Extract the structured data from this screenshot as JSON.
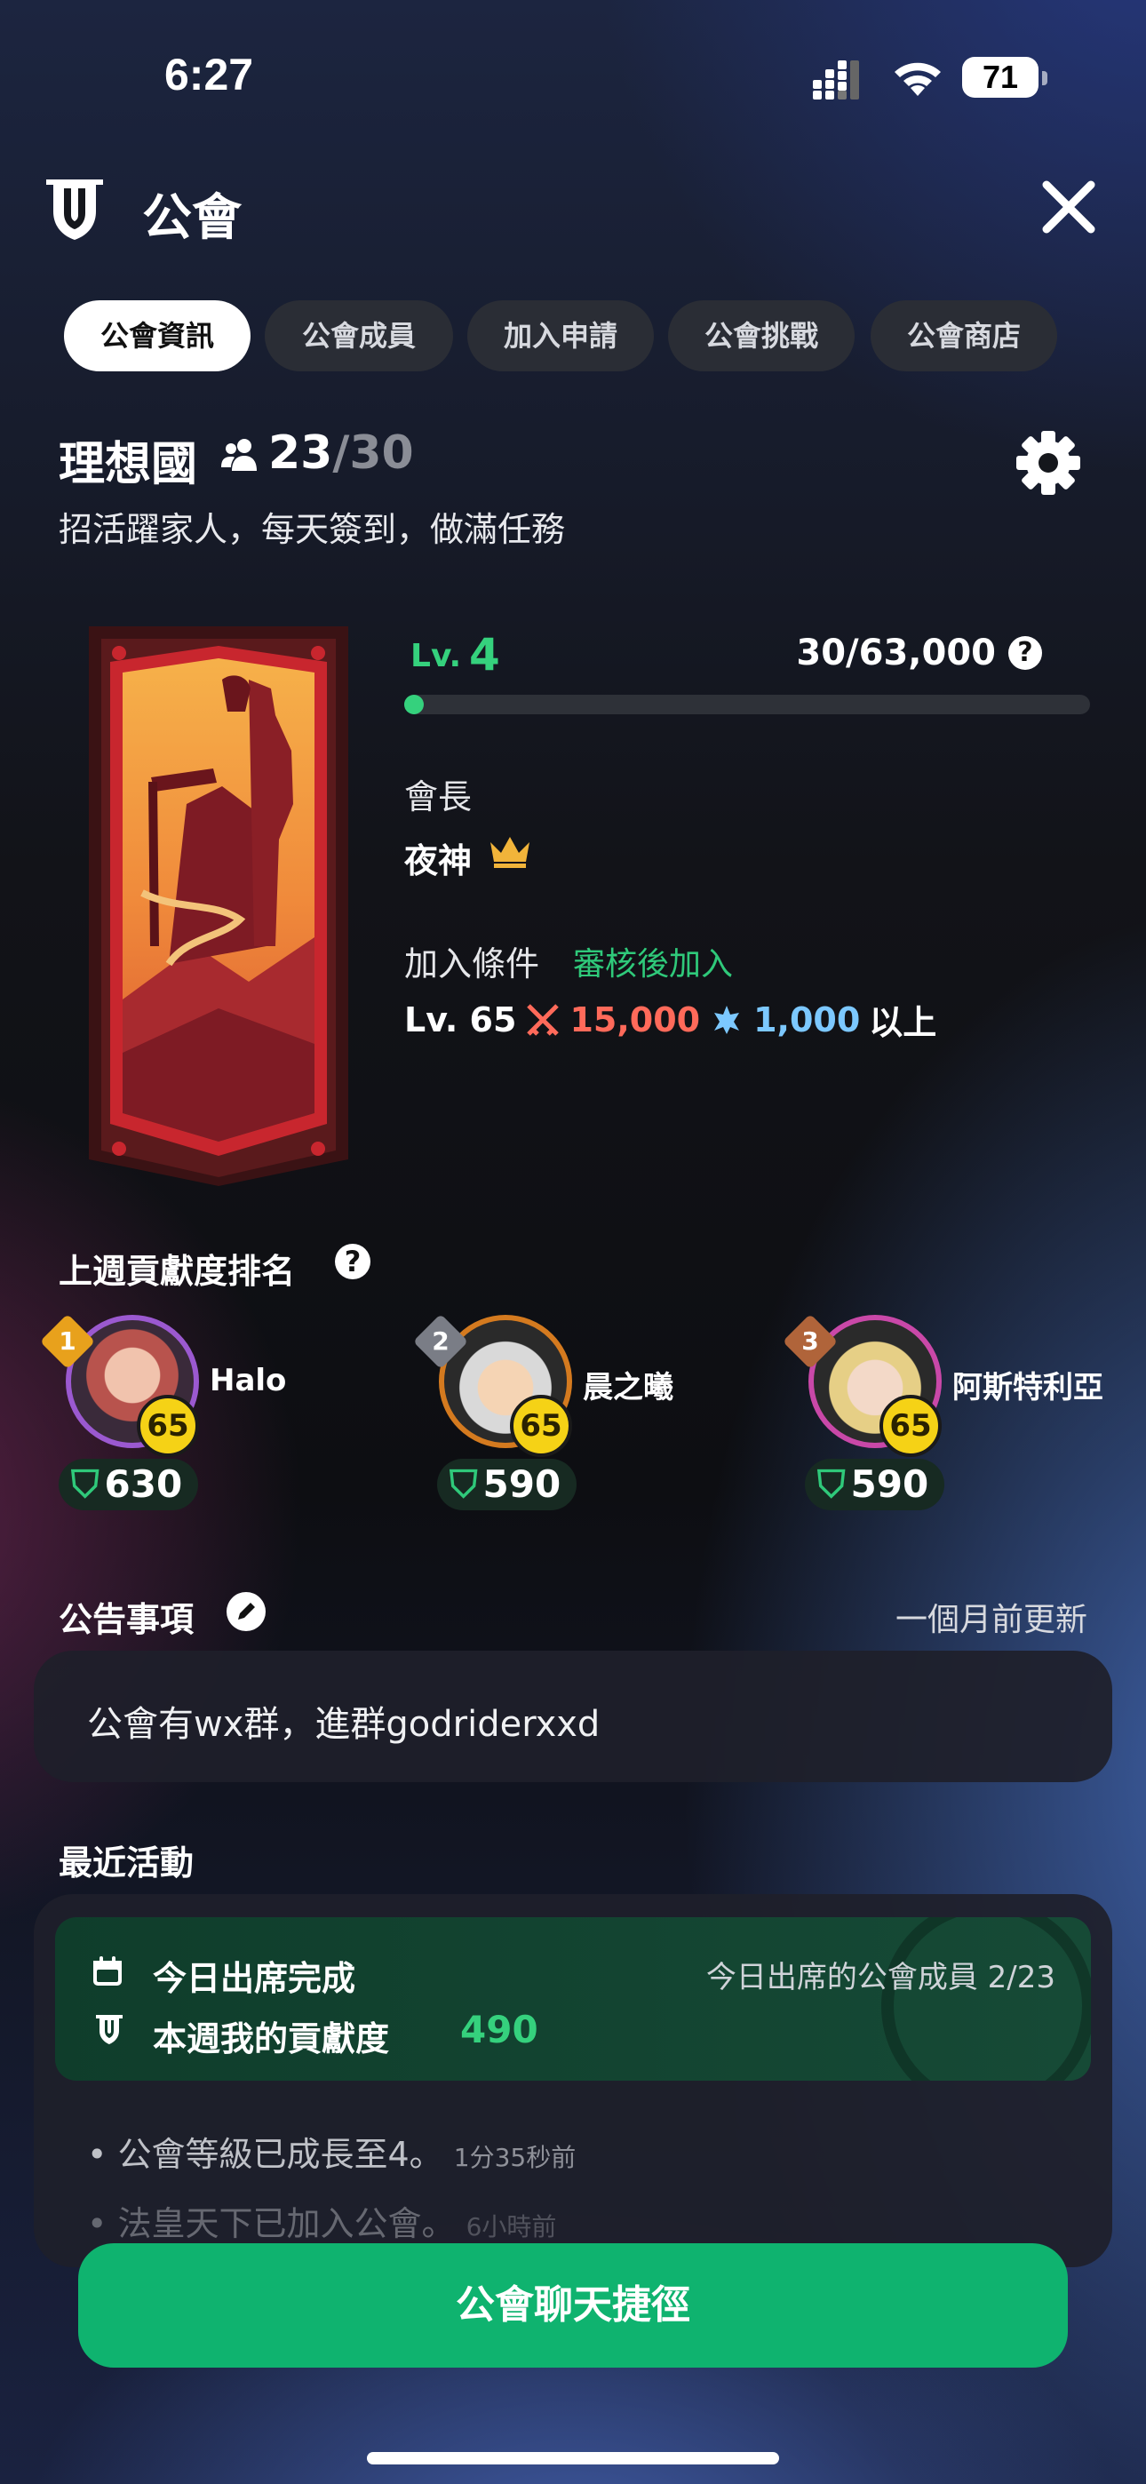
{
  "status_bar": {
    "time": "6:27",
    "battery": "71"
  },
  "header": {
    "title": "公會",
    "close_icon": "close-icon",
    "guild_icon": "guild-shield-icon"
  },
  "tabs": [
    {
      "label": "公會資訊",
      "active": true
    },
    {
      "label": "公會成員",
      "active": false
    },
    {
      "label": "加入申請",
      "active": false
    },
    {
      "label": "公會挑戰",
      "active": false
    },
    {
      "label": "公會商店",
      "active": false
    }
  ],
  "guild": {
    "name": "理想國",
    "members_current": "23",
    "members_max": "/30",
    "description": "招活躍家人，每天簽到，做滿任務",
    "level_label": "Lv.",
    "level": "4",
    "exp_text": "30/63,000",
    "exp_fraction": 0.0005,
    "leader_label": "會長",
    "leader_name": "夜神",
    "join_label": "加入條件",
    "join_mode": "審核後加入",
    "req_level": "Lv. 65",
    "req_attack": "15,000",
    "req_defense": "1,000",
    "req_suffix": "以上"
  },
  "ranking": {
    "title": "上週貢獻度排名",
    "entries": [
      {
        "rank": "1",
        "name": "Halo",
        "level": "65",
        "points": "630",
        "ring_color": "#9b59d0",
        "badge_color": "#e8a11c"
      },
      {
        "rank": "2",
        "name": "晨之曦",
        "level": "65",
        "points": "590",
        "ring_color": "#d47a1f",
        "badge_color": "#7a7d86"
      },
      {
        "rank": "3",
        "name": "阿斯特利亞",
        "level": "65",
        "points": "590",
        "ring_color": "#c948a8",
        "badge_color": "#b0643a"
      }
    ]
  },
  "announcement": {
    "title": "公告事項",
    "updated": "一個月前更新",
    "text": "公會有wx群，進群godriderxxd"
  },
  "activity": {
    "title": "最近活動",
    "attendance_label": "今日出席完成",
    "attendance_count": "今日出席的公會成員 2/23",
    "contribution_label": "本週我的貢獻度",
    "contribution_value": "490",
    "items": [
      {
        "text": "公會等級已成長至4。",
        "ago": "1分35秒前"
      },
      {
        "text": "法皇天下已加入公會。",
        "ago": "6小時前"
      }
    ]
  },
  "cta": {
    "label": "公會聊天捷徑"
  },
  "colors": {
    "accent_green": "#35d17d",
    "cta_green": "#0fb36f",
    "attack_red": "#ff6a5a",
    "defense_blue": "#7cc8ff"
  }
}
